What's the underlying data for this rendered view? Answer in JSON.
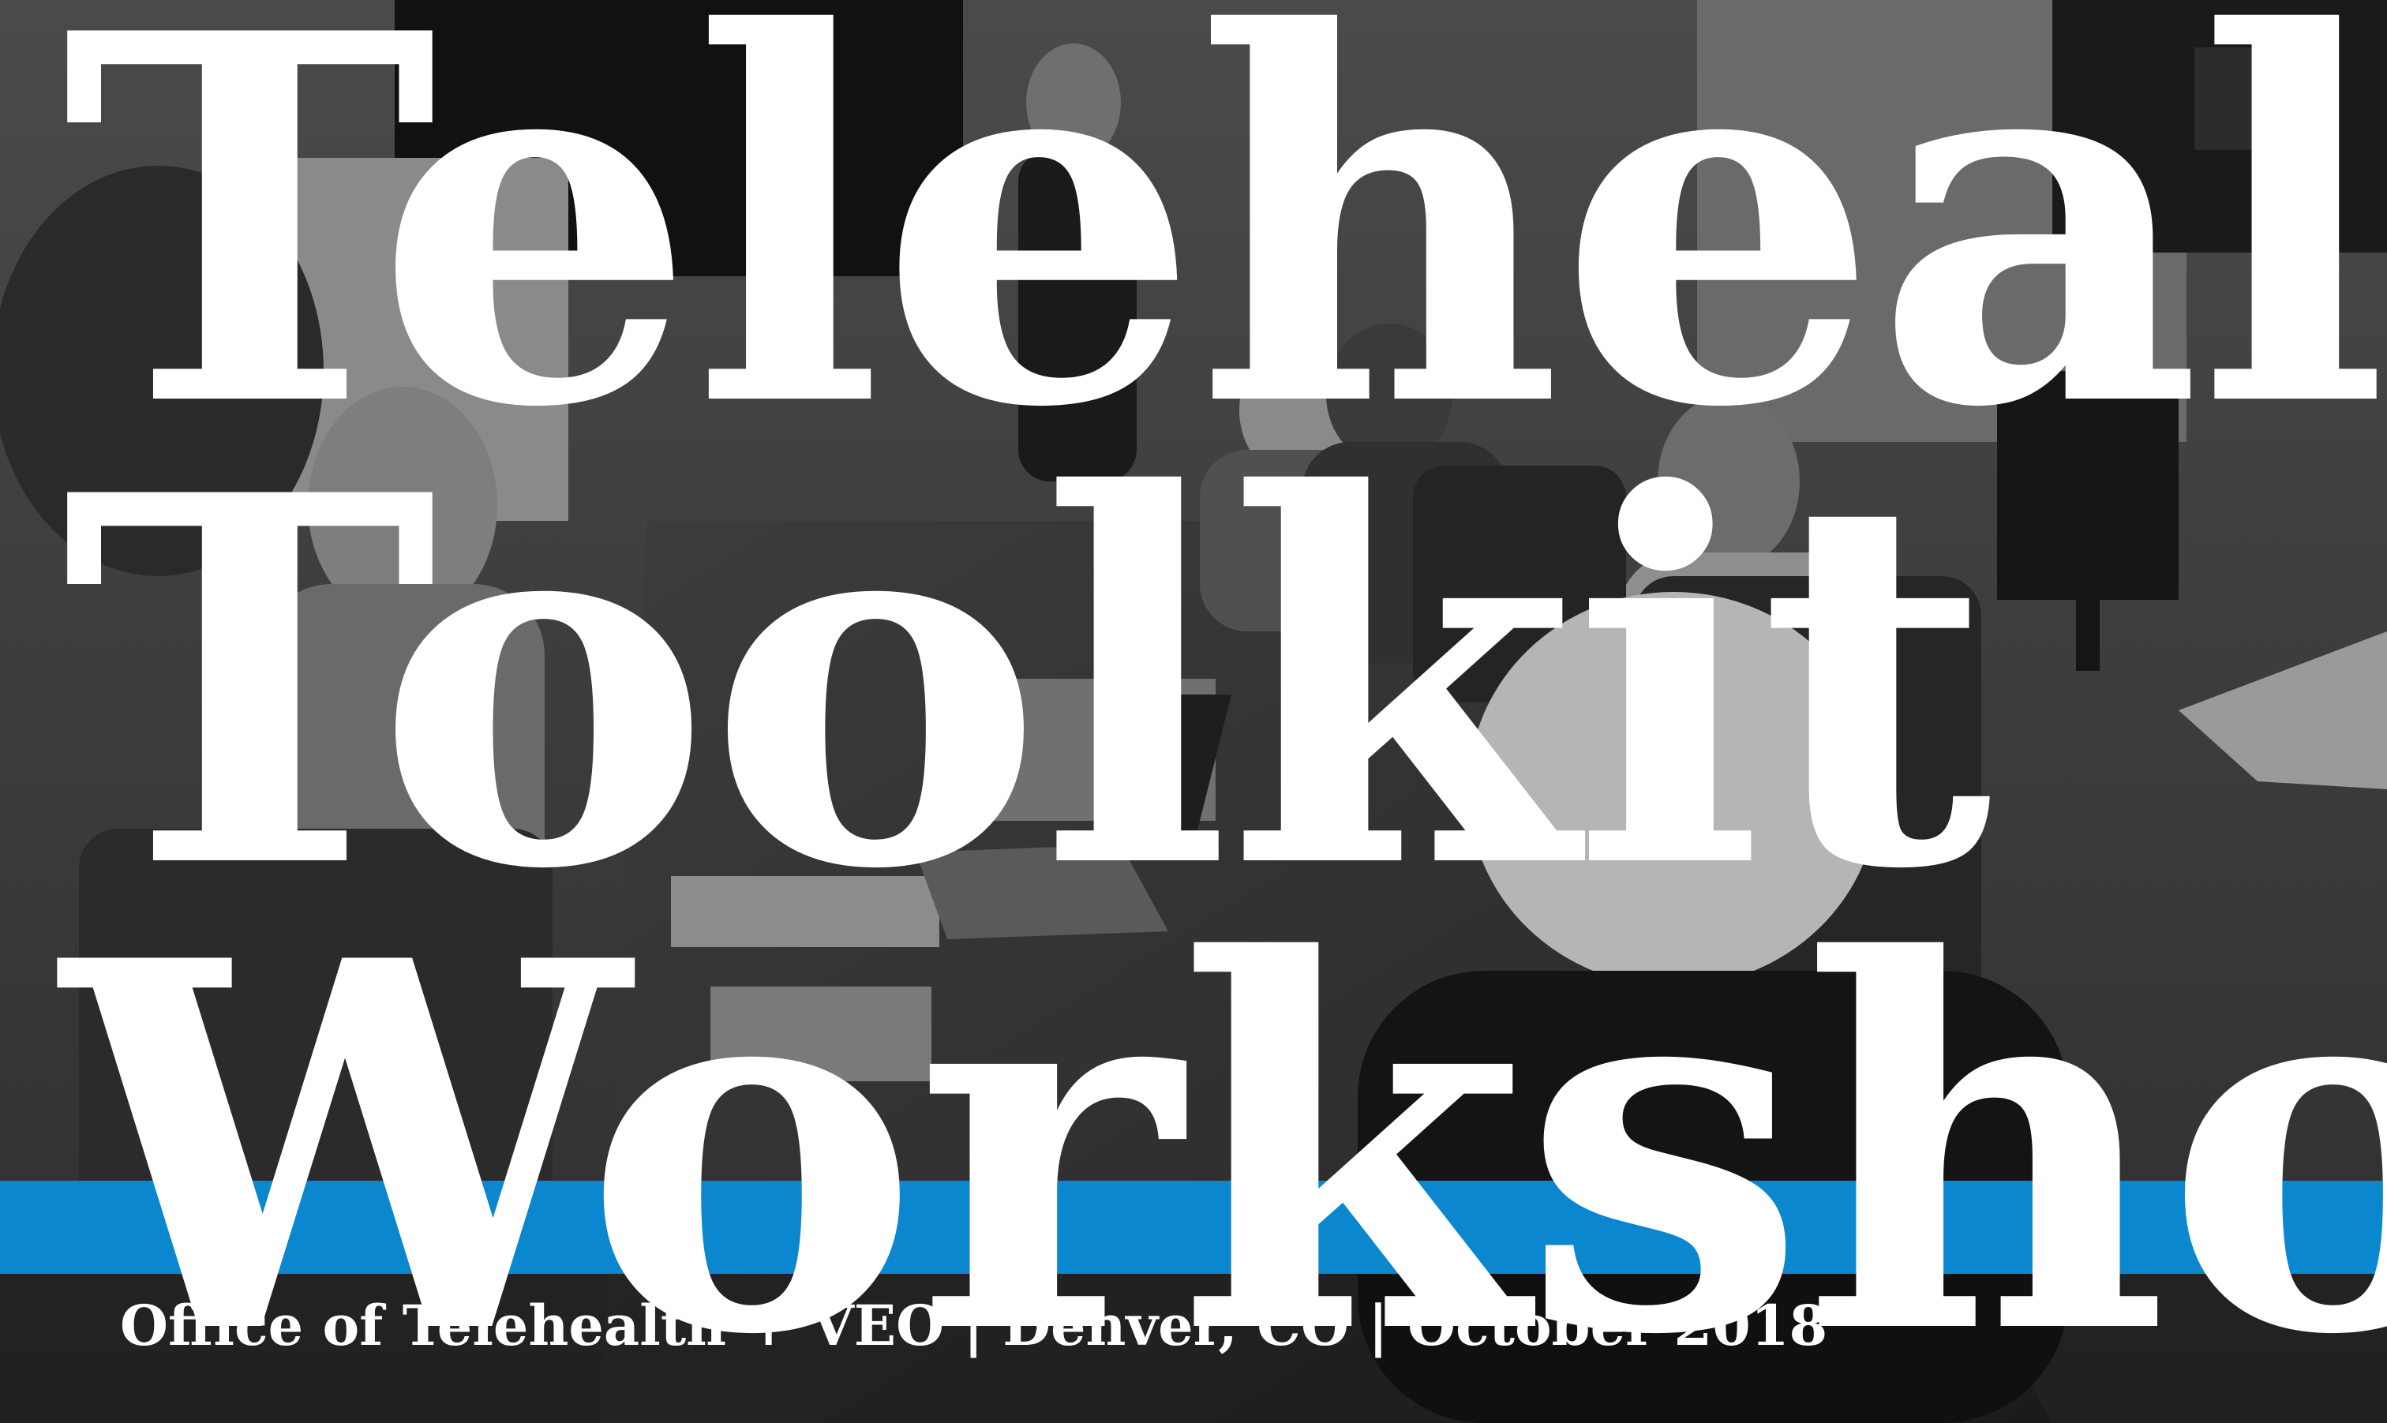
{
  "poster": {
    "title_lines": [
      "Telehealth",
      "Toolkit",
      "Workshop"
    ],
    "subtitle": "Office of Telehealth + VEO | Denver, CO | October 2018"
  },
  "colors": {
    "accent_bar": "#0b87cf",
    "title_text": "#ffffff",
    "photo_tone": "grayscale"
  }
}
